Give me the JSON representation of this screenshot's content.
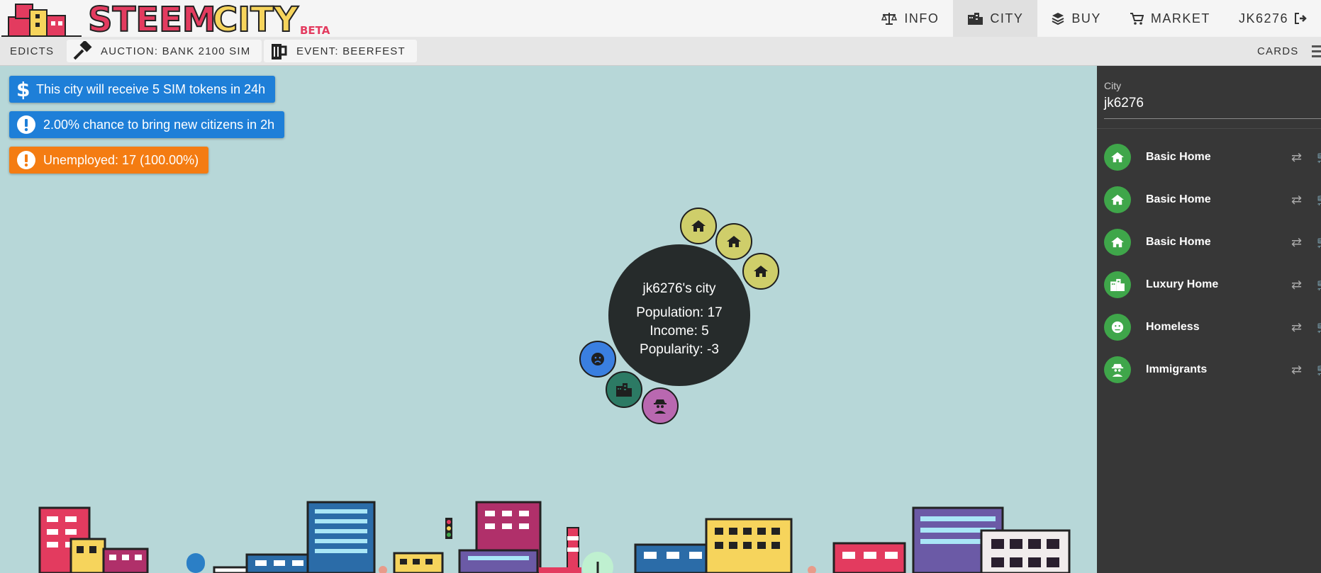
{
  "nav": {
    "info": "INFO",
    "city": "CITY",
    "buy": "BUY",
    "market": "MARKET",
    "user": "JK6276"
  },
  "subnav": {
    "edicts": "EDICTS",
    "auction": "AUCTION: BANK 2100 SIM",
    "event": "EVENT: BEERFEST",
    "cards": "CARDS"
  },
  "alerts": [
    {
      "text": "This city will receive 5 SIM tokens in 24h",
      "color": "#1e7fd8",
      "icon": "dollar-icon"
    },
    {
      "text": "2.00% chance to bring new citizens in 2h",
      "color": "#1e7fd8",
      "icon": "exclamation-icon"
    },
    {
      "text": "Unemployed: 17 (100.00%)",
      "color": "#f47c12",
      "icon": "exclamation-icon"
    }
  ],
  "city_summary": {
    "title": "jk6276's city",
    "population": "Population: 17",
    "income": "Income: 5",
    "popularity": "Popularity: -3"
  },
  "panel": {
    "label": "City",
    "city_name": "jk6276",
    "items": [
      {
        "name": "Basic Home",
        "icon": "home-icon"
      },
      {
        "name": "Basic Home",
        "icon": "home-icon"
      },
      {
        "name": "Basic Home",
        "icon": "home-icon"
      },
      {
        "name": "Luxury Home",
        "icon": "building-icon"
      },
      {
        "name": "Homeless",
        "icon": "face-icon"
      },
      {
        "name": "Immigrants",
        "icon": "spy-icon"
      }
    ]
  },
  "colors": {
    "map_bg": "#b7d7d8",
    "panel_bg": "#373737",
    "accent_green": "#3fa64a",
    "home_bubble": "#cfce6a",
    "homeless_bubble": "#3a7fe0",
    "luxury_bubble": "#2c7a64",
    "immigrant_bubble": "#b968b0"
  }
}
